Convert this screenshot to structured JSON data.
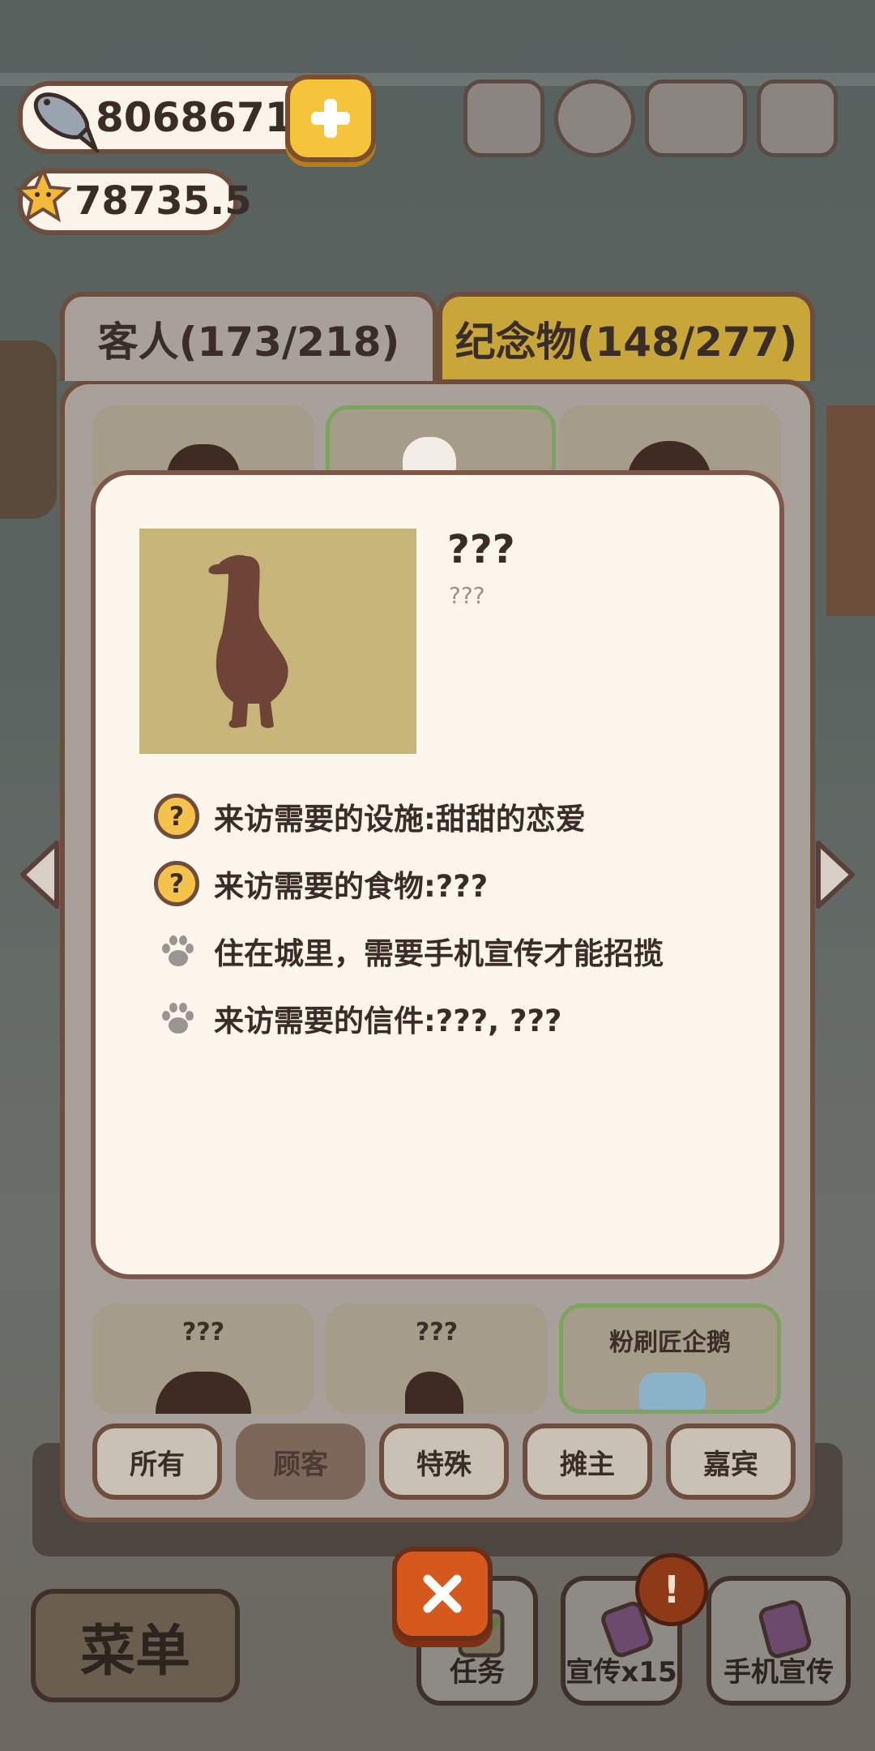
{
  "hud": {
    "fish_count": "8068671",
    "star_count": "78735.5"
  },
  "tabs": {
    "guests": "客人(173/218)",
    "souvenirs": "纪念物(148/277)"
  },
  "grid_bottom": [
    {
      "name": "???"
    },
    {
      "name": "???"
    },
    {
      "name": "粉刷匠企鹅"
    }
  ],
  "modal": {
    "name": "???",
    "subtitle": "???",
    "requirements": [
      {
        "icon": "question-icon",
        "text": "来访需要的设施:甜甜的恋爱"
      },
      {
        "icon": "question-icon",
        "text": "来访需要的食物:???"
      },
      {
        "icon": "paw-icon",
        "text": "住在城里，需要手机宣传才能招揽"
      },
      {
        "icon": "paw-icon",
        "text": "来访需要的信件:???, ???"
      }
    ]
  },
  "filters": [
    "所有",
    "顾客",
    "特殊",
    "摊主",
    "嘉宾"
  ],
  "active_filter": "顾客",
  "bottom_bar": {
    "menu": "菜单",
    "tasks": "任务",
    "promo_x15": "宣传x15",
    "phone_promo": "手机宣传",
    "alert": "!"
  },
  "colors": {
    "accent_yellow": "#f6c43a",
    "brown_border": "#6e4d3d",
    "modal_bg": "#fdf6ed",
    "close_orange": "#d5581c"
  }
}
